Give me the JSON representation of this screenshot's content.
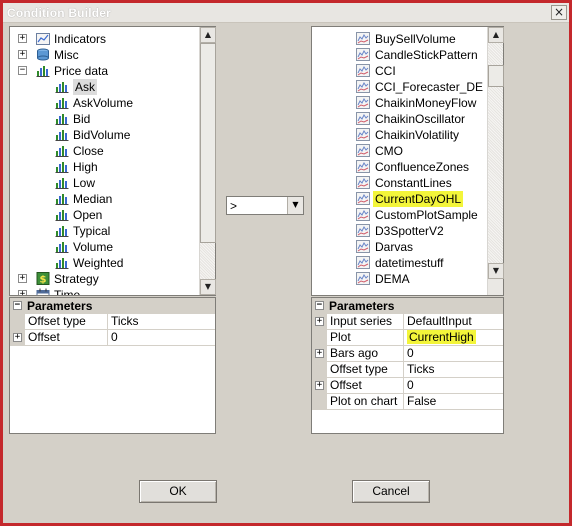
{
  "window": {
    "title": "Condition Builder",
    "close_glyph": "×"
  },
  "left_tree": {
    "items": [
      {
        "label": "Indicators",
        "expander": "+",
        "icon": "indicators-folder-icon"
      },
      {
        "label": "Misc",
        "expander": "+",
        "icon": "misc-database-icon"
      },
      {
        "label": "Price data",
        "expander": "−",
        "icon": "price-data-chart-icon"
      },
      {
        "label": "Ask",
        "icon": "bar-chart-icon",
        "selected": true
      },
      {
        "label": "AskVolume",
        "icon": "bar-chart-icon"
      },
      {
        "label": "Bid",
        "icon": "bar-chart-icon"
      },
      {
        "label": "BidVolume",
        "icon": "bar-chart-icon"
      },
      {
        "label": "Close",
        "icon": "bar-chart-icon"
      },
      {
        "label": "High",
        "icon": "bar-chart-icon"
      },
      {
        "label": "Low",
        "icon": "bar-chart-icon"
      },
      {
        "label": "Median",
        "icon": "bar-chart-icon"
      },
      {
        "label": "Open",
        "icon": "bar-chart-icon"
      },
      {
        "label": "Typical",
        "icon": "bar-chart-icon"
      },
      {
        "label": "Volume",
        "icon": "bar-chart-icon"
      },
      {
        "label": "Weighted",
        "icon": "bar-chart-icon"
      },
      {
        "label": "Strategy",
        "expander": "+",
        "icon": "strategy-dollar-icon"
      },
      {
        "label": "Time",
        "expander": "+",
        "icon": "time-calendar-icon"
      }
    ]
  },
  "operator": {
    "value": ">"
  },
  "right_tree": {
    "items": [
      {
        "label": "BuySellVolume"
      },
      {
        "label": "CandleStickPattern"
      },
      {
        "label": "CCI"
      },
      {
        "label": "CCI_Forecaster_DE"
      },
      {
        "label": "ChaikinMoneyFlow"
      },
      {
        "label": "ChaikinOscillator"
      },
      {
        "label": "ChaikinVolatility"
      },
      {
        "label": "CMO"
      },
      {
        "label": "ConfluenceZones"
      },
      {
        "label": "ConstantLines"
      },
      {
        "label": "CurrentDayOHL",
        "highlighted": true
      },
      {
        "label": "CustomPlotSample"
      },
      {
        "label": "D3SpotterV2"
      },
      {
        "label": "Darvas"
      },
      {
        "label": "datetimestuff"
      },
      {
        "label": "DEMA"
      }
    ]
  },
  "left_params": {
    "header": "Parameters",
    "header_expander": "−",
    "rows": [
      {
        "name": "Offset type",
        "value": "Ticks"
      },
      {
        "name": "Offset",
        "value": "0",
        "expander": "+"
      }
    ]
  },
  "right_params": {
    "header": "Parameters",
    "header_expander": "−",
    "rows": [
      {
        "name": "Input series",
        "value": "DefaultInput",
        "expander": "+"
      },
      {
        "name": "Plot",
        "value": "CurrentHigh",
        "highlighted": true
      },
      {
        "name": "Bars ago",
        "value": "0",
        "expander": "+"
      },
      {
        "name": "Offset type",
        "value": "Ticks"
      },
      {
        "name": "Offset",
        "value": "0",
        "expander": "+"
      },
      {
        "name": "Plot on chart",
        "value": "False"
      }
    ]
  },
  "buttons": {
    "ok_label": "OK",
    "cancel_label": "Cancel"
  },
  "scroll_glyphs": {
    "up": "▲",
    "down": "▼"
  }
}
